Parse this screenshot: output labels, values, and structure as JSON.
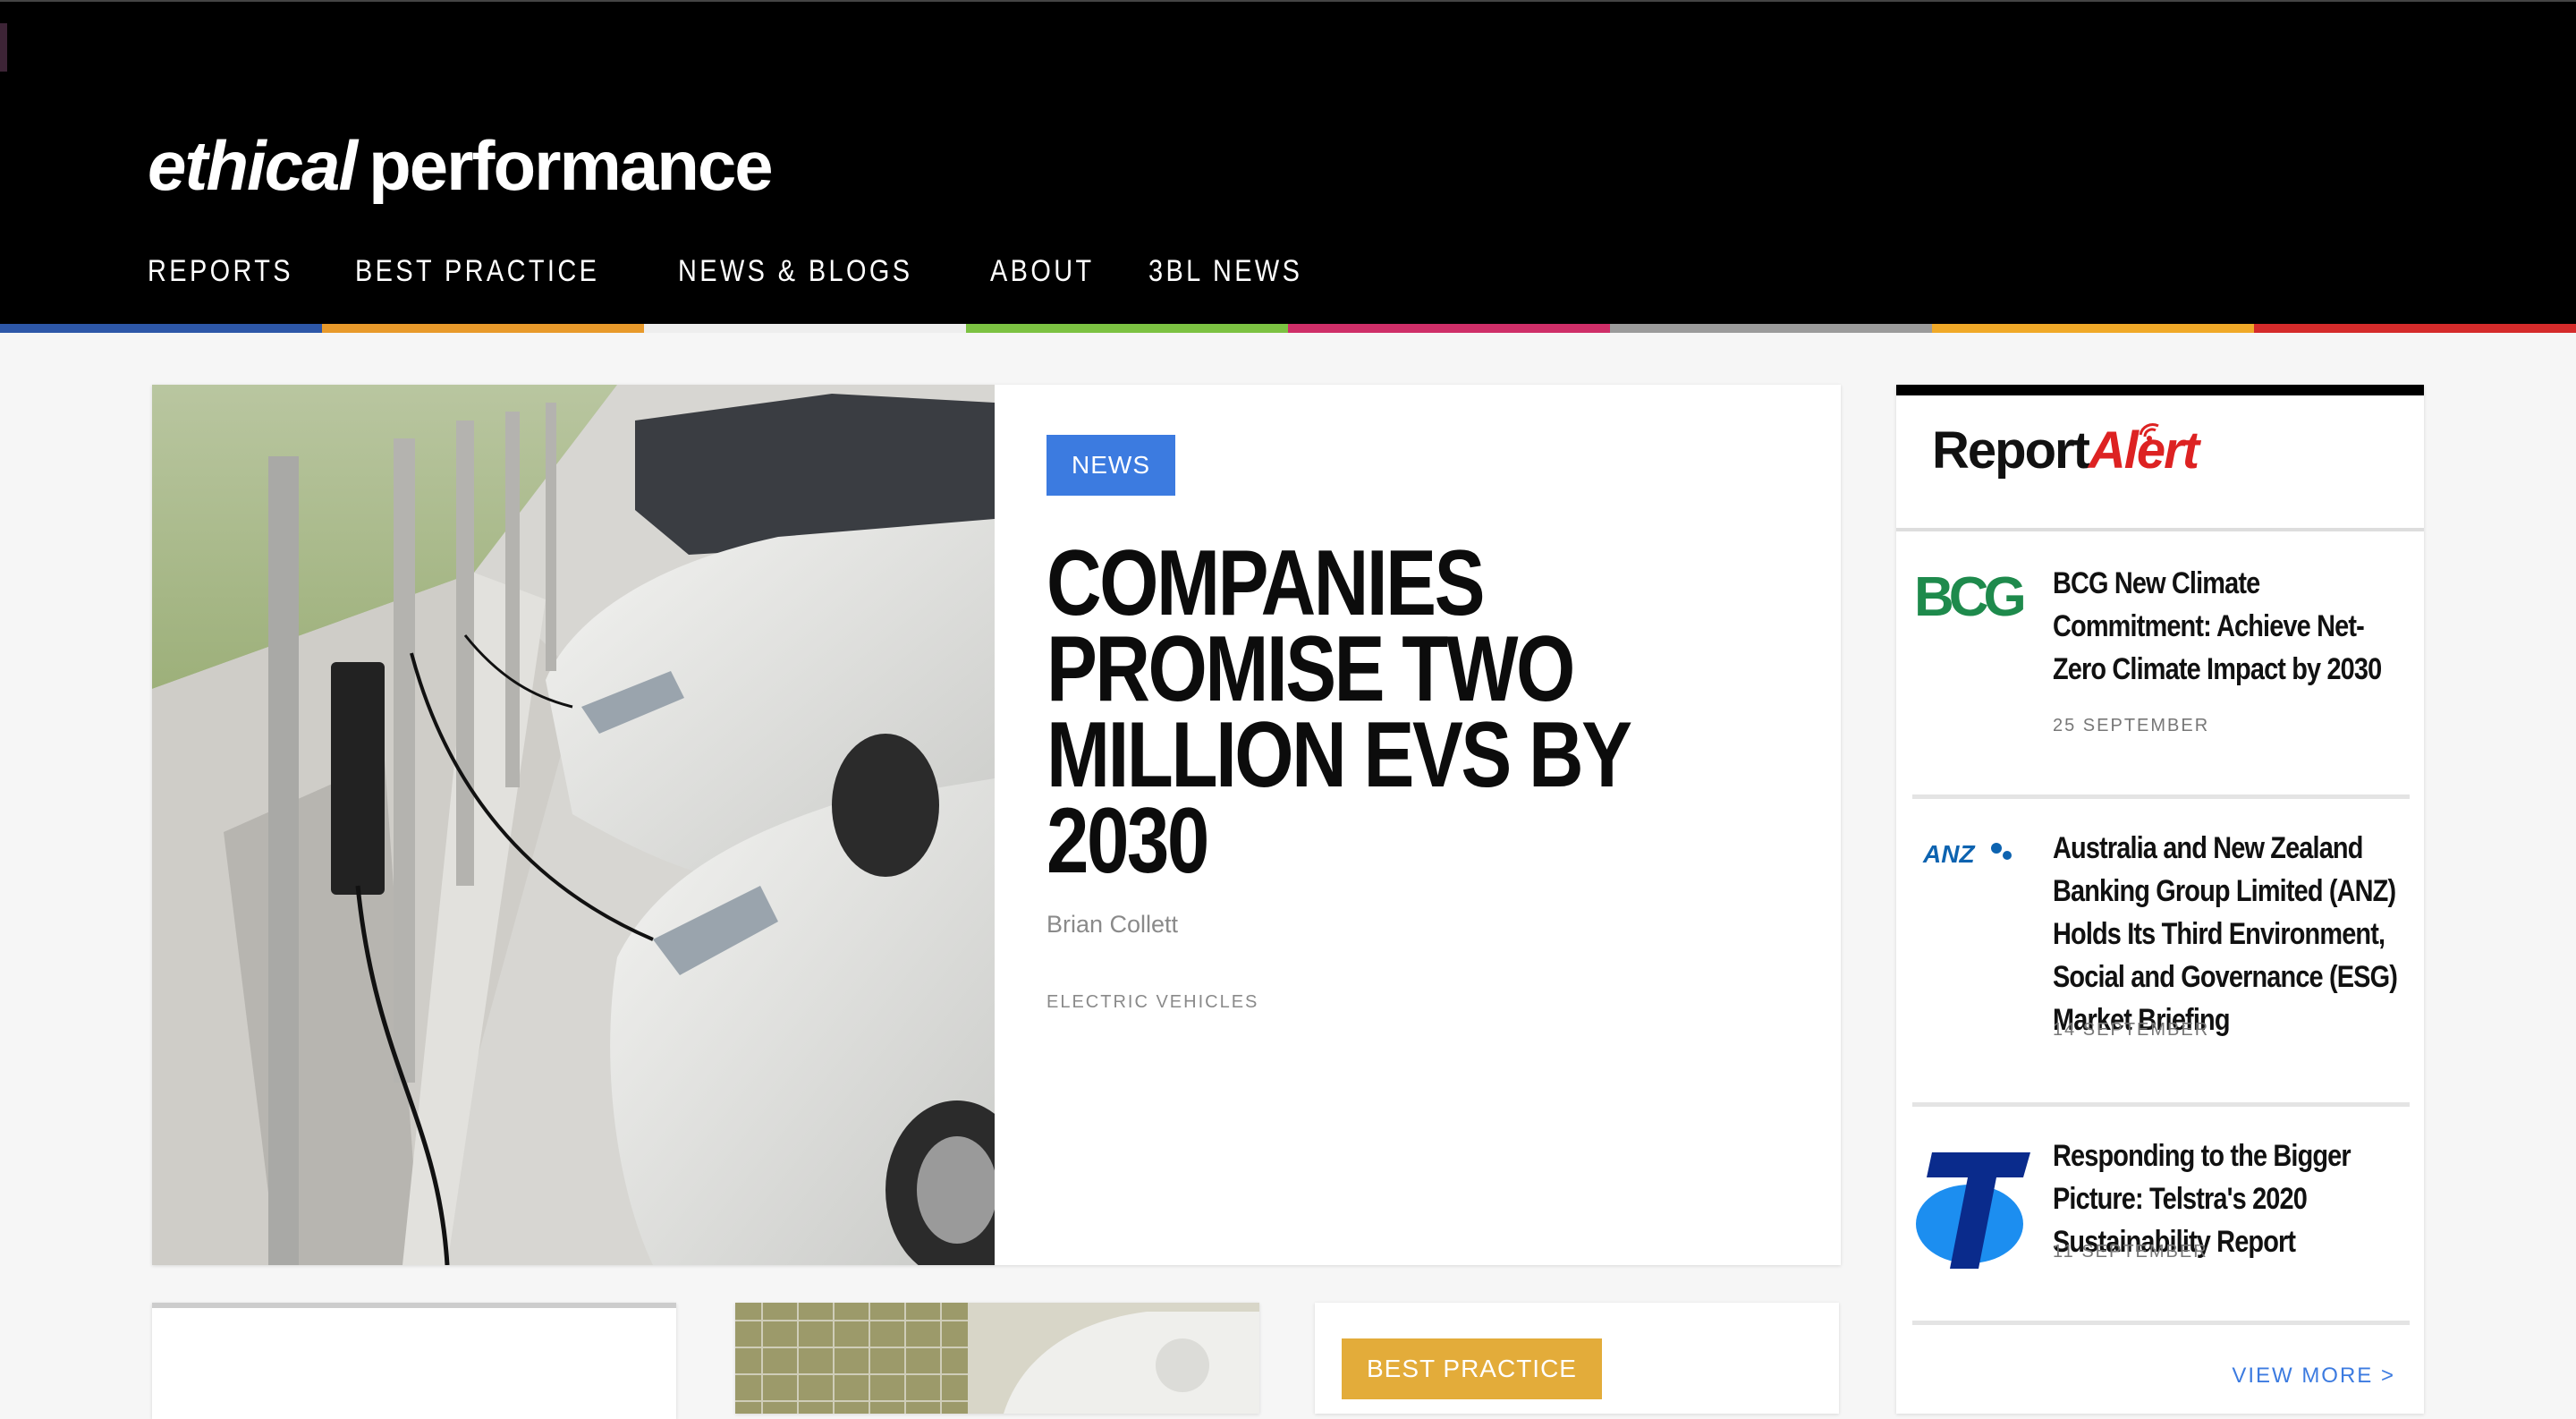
{
  "site": {
    "logo_italic": "ethical",
    "logo_regular": "performance"
  },
  "nav": [
    {
      "label": "REPORTS"
    },
    {
      "label": "BEST PRACTICE"
    },
    {
      "label": "NEWS & BLOGS"
    },
    {
      "label": "ABOUT"
    },
    {
      "label": "3BL NEWS"
    }
  ],
  "colors": {
    "strip": [
      "#2d57a8",
      "#e89a2b",
      "#eeeeee",
      "#7cc242",
      "#cf2e68",
      "#9b9b9b",
      "#f0a928",
      "#d52b2b"
    ],
    "news_tag": "#3c7be0",
    "best_practice_tag": "#e3ac3a",
    "alert_red": "#dd2222",
    "link_blue": "#3c7be0"
  },
  "feature": {
    "tag": "NEWS",
    "headline": "COMPANIES PROMISE TWO MILLION EVS BY 2030",
    "author": "Brian Collett",
    "category": "ELECTRIC VEHICLES",
    "image_icon": "electric-car-charging-photo"
  },
  "cards": [
    {
      "tag": ""
    },
    {
      "tag": ""
    },
    {
      "tag": "BEST PRACTICE"
    }
  ],
  "sidebar": {
    "logo_report": "Report",
    "logo_alert": "Alert",
    "items": [
      {
        "logo_text": "BCG",
        "title": "BCG New Climate Commitment: Achieve Net-Zero Climate Impact by 2030",
        "date": "25 SEPTEMBER"
      },
      {
        "logo_text": "ANZ",
        "title": "Australia and New Zealand Banking Group Limited (ANZ) Holds Its Third Environment, Social and Governance (ESG) Market Briefing",
        "date": "14 SEPTEMBER"
      },
      {
        "logo_text": "T",
        "title": "Responding to the Bigger Picture: Telstra's 2020 Sustainability Report",
        "date": "11 SEPTEMBER"
      }
    ],
    "view_more": "VIEW MORE >"
  }
}
